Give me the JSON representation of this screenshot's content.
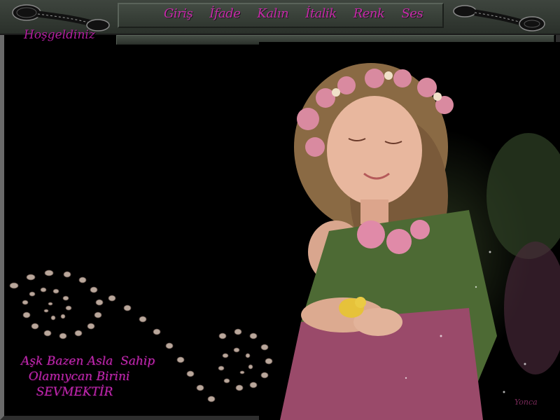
{
  "header": {
    "welcome": "Hoşgeldiniz",
    "menu": [
      {
        "label": "Giriş"
      },
      {
        "label": "İfade"
      },
      {
        "label": "Kalın"
      },
      {
        "label": "İtalik"
      },
      {
        "label": "Renk"
      },
      {
        "label": "Ses"
      }
    ]
  },
  "quote": {
    "line1": "Aşk Bazen Asla  Sahip",
    "line2": "  Olamıycan Birini",
    "line3": "    SEVMEKTİR"
  },
  "signature": "Yonca",
  "colors": {
    "accent": "#c52aa8",
    "bar": "#3a423a"
  },
  "icons": [
    "film-reel-icon",
    "film-reel-icon",
    "dotted-swirl-decoration"
  ]
}
